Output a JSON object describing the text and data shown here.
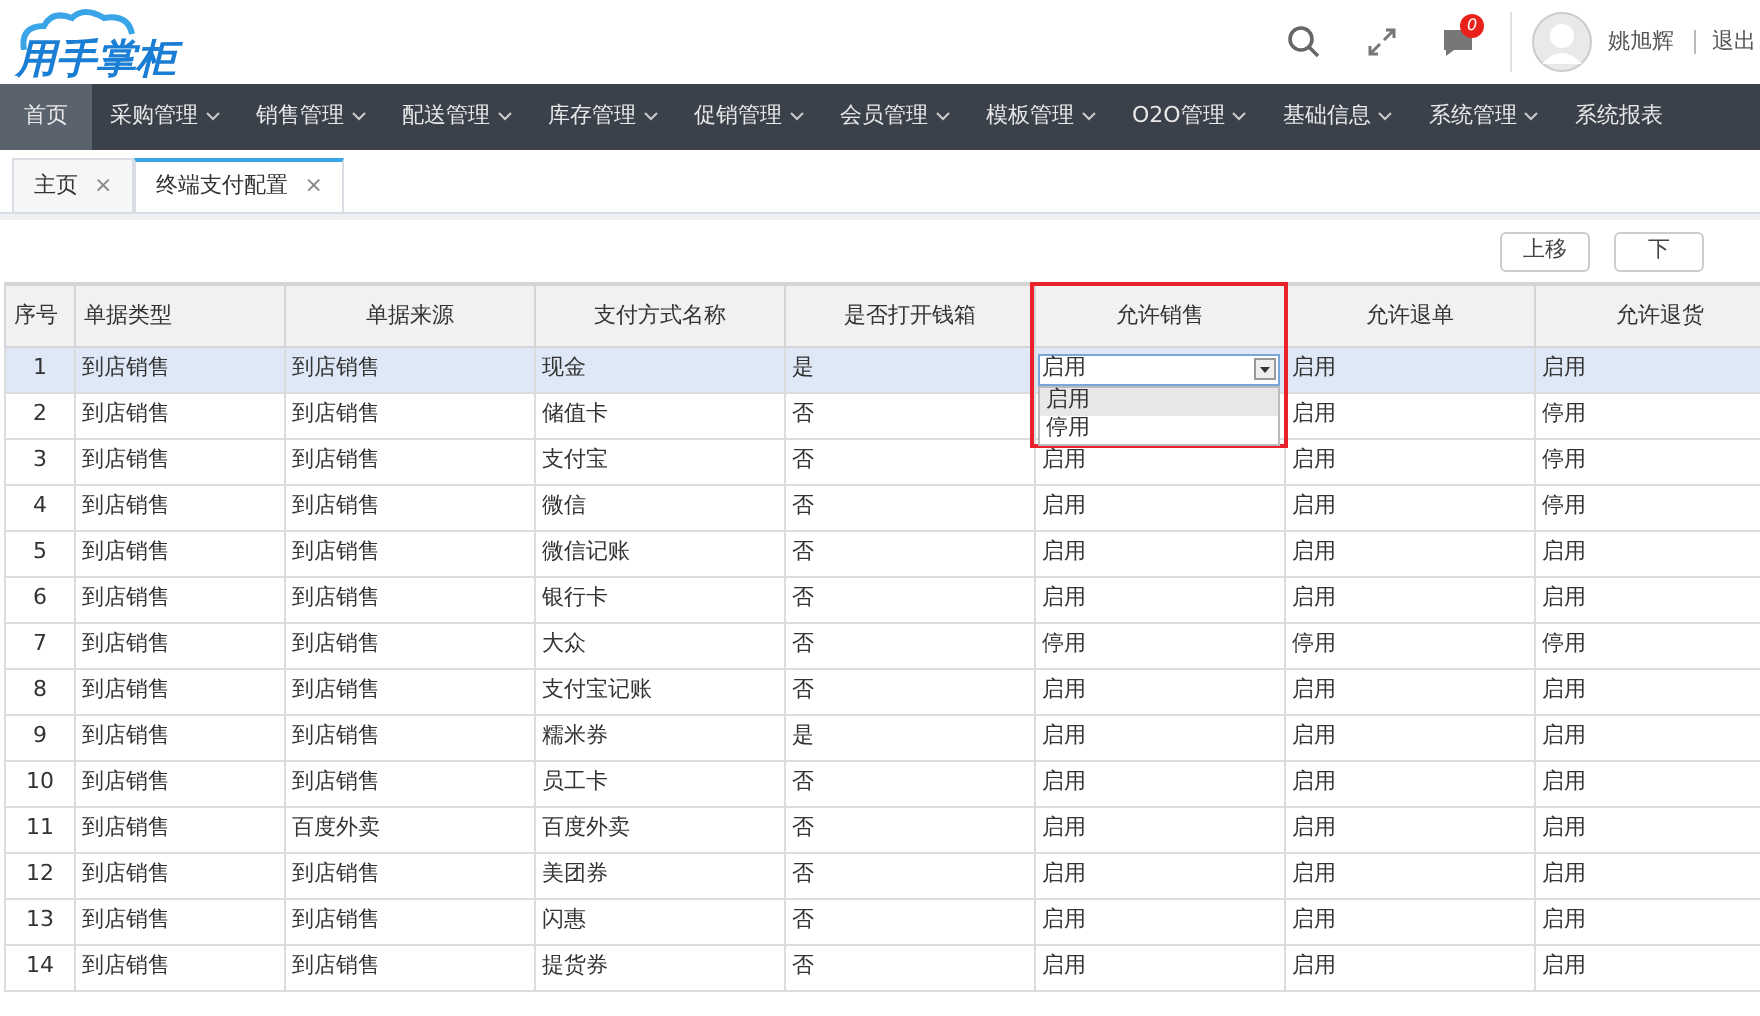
{
  "header": {
    "logo": "用手掌柜",
    "notification_count": "0",
    "user_name": "姚旭辉",
    "logout": "退出"
  },
  "nav": [
    {
      "label": "首页",
      "selected": true,
      "caret": false
    },
    {
      "label": "采购管理",
      "selected": false,
      "caret": true
    },
    {
      "label": "销售管理",
      "selected": false,
      "caret": true
    },
    {
      "label": "配送管理",
      "selected": false,
      "caret": true
    },
    {
      "label": "库存管理",
      "selected": false,
      "caret": true
    },
    {
      "label": "促销管理",
      "selected": false,
      "caret": true
    },
    {
      "label": "会员管理",
      "selected": false,
      "caret": true
    },
    {
      "label": "模板管理",
      "selected": false,
      "caret": true
    },
    {
      "label": "O2O管理",
      "selected": false,
      "caret": true
    },
    {
      "label": "基础信息",
      "selected": false,
      "caret": true
    },
    {
      "label": "系统管理",
      "selected": false,
      "caret": true
    },
    {
      "label": "系统报表",
      "selected": false,
      "caret": false
    }
  ],
  "tabs": [
    {
      "label": "主页",
      "close": "×",
      "selected": false
    },
    {
      "label": "终端支付配置",
      "close": "×",
      "selected": true
    }
  ],
  "toolbar": {
    "buttons": [
      "上移",
      "下"
    ]
  },
  "table": {
    "columns": [
      "序号",
      "单据类型",
      "单据来源",
      "支付方式名称",
      "是否打开钱箱",
      "允许销售",
      "允许退单",
      "允许退货"
    ],
    "rows": [
      {
        "selected": true,
        "cells": [
          "1",
          "到店销售",
          "到店销售",
          "现金",
          "是",
          null,
          "启用",
          "启用"
        ],
        "editor": {
          "value": "启用",
          "expanded": true,
          "options": [
            {
              "label": "启用",
              "selected": true
            },
            {
              "label": "停用",
              "selected": false
            }
          ]
        }
      },
      {
        "selected": false,
        "cells": [
          "2",
          "到店销售",
          "到店销售",
          "储值卡",
          "否",
          null,
          "启用",
          "停用"
        ]
      },
      {
        "selected": false,
        "cells": [
          "3",
          "到店销售",
          "到店销售",
          "支付宝",
          "否",
          "启用",
          "启用",
          "停用"
        ]
      },
      {
        "selected": false,
        "cells": [
          "4",
          "到店销售",
          "到店销售",
          "微信",
          "否",
          "启用",
          "启用",
          "停用"
        ]
      },
      {
        "selected": false,
        "cells": [
          "5",
          "到店销售",
          "到店销售",
          "微信记账",
          "否",
          "启用",
          "启用",
          "启用"
        ]
      },
      {
        "selected": false,
        "cells": [
          "6",
          "到店销售",
          "到店销售",
          "银行卡",
          "否",
          "启用",
          "启用",
          "启用"
        ]
      },
      {
        "selected": false,
        "cells": [
          "7",
          "到店销售",
          "到店销售",
          "大众",
          "否",
          "停用",
          "停用",
          "停用"
        ]
      },
      {
        "selected": false,
        "cells": [
          "8",
          "到店销售",
          "到店销售",
          "支付宝记账",
          "否",
          "启用",
          "启用",
          "启用"
        ]
      },
      {
        "selected": false,
        "cells": [
          "9",
          "到店销售",
          "到店销售",
          "糯米券",
          "是",
          "启用",
          "启用",
          "启用"
        ]
      },
      {
        "selected": false,
        "cells": [
          "10",
          "到店销售",
          "到店销售",
          "员工卡",
          "否",
          "启用",
          "启用",
          "启用"
        ]
      },
      {
        "selected": false,
        "cells": [
          "11",
          "到店销售",
          "百度外卖",
          "百度外卖",
          "否",
          "启用",
          "启用",
          "启用"
        ]
      },
      {
        "selected": false,
        "cells": [
          "12",
          "到店销售",
          "到店销售",
          "美团券",
          "否",
          "启用",
          "启用",
          "启用"
        ]
      },
      {
        "selected": false,
        "cells": [
          "13",
          "到店销售",
          "到店销售",
          "闪惠",
          "否",
          "启用",
          "启用",
          "启用"
        ]
      },
      {
        "selected": false,
        "cells": [
          "14",
          "到店销售",
          "到店销售",
          "提货券",
          "否",
          "启用",
          "启用",
          "启用"
        ]
      }
    ]
  }
}
